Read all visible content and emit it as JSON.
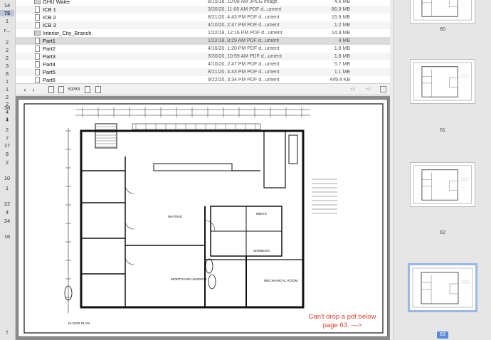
{
  "gutter": {
    "numbers": [
      "14",
      "75",
      "1",
      "2",
      "2",
      "2",
      "3",
      "8",
      "1",
      "1",
      "2",
      "2",
      "4",
      "4",
      "38",
      "1",
      "2",
      "7",
      "17",
      "8",
      "2",
      "10",
      "1",
      "22",
      "4",
      "24",
      "16"
    ],
    "truncated_label": "r...",
    "highlight_value": "75"
  },
  "files": [
    {
      "name": "GHU Water",
      "date": "8/15/18, 10:08 AM",
      "kind": "JPEG image",
      "size": "4.6 MB",
      "icon": "image-file-icon"
    },
    {
      "name": "ICB 1",
      "date": "3/30/20, 11:00 AM",
      "kind": "PDF d...ument",
      "size": "86.9 MB",
      "icon": "pdf-file-icon"
    },
    {
      "name": "ICB 2",
      "date": "8/21/20, 4:43 PM",
      "kind": "PDF d...ument",
      "size": "15.9 MB",
      "icon": "pdf-file-icon"
    },
    {
      "name": "ICB 3",
      "date": "4/10/20, 2:47 PM",
      "kind": "PDF d...ument",
      "size": "1.2 MB",
      "icon": "pdf-file-icon"
    },
    {
      "name": "Interior_City_Branch",
      "date": "1/22/18, 12:16 PM",
      "kind": "PDF d...ument",
      "size": "14.9 MB",
      "icon": "image-file-icon"
    },
    {
      "name": "Part1",
      "date": "1/22/18, 8:29 AM",
      "kind": "PDF d...ument",
      "size": "4 MB",
      "icon": "pdf-file-icon",
      "selected": true
    },
    {
      "name": "Part2",
      "date": "4/16/20, 1:20 PM",
      "kind": "PDF d...ument",
      "size": "1.8 MB",
      "icon": "pdf-file-icon"
    },
    {
      "name": "Part3",
      "date": "3/30/20, 10:59 AM",
      "kind": "PDF d...ument",
      "size": "1.8 MB",
      "icon": "pdf-file-icon"
    },
    {
      "name": "Part4",
      "date": "4/10/20, 2:47 PM",
      "kind": "PDF d...ument",
      "size": "5.7 MB",
      "icon": "pdf-file-icon"
    },
    {
      "name": "Part5",
      "date": "8/21/20, 4:43 PM",
      "kind": "PDF d...ument",
      "size": "1.1 MB",
      "icon": "pdf-file-icon"
    },
    {
      "name": "Part6",
      "date": "9/22/20, 3:34 PM",
      "kind": "PDF d...ument",
      "size": "449.4 KB",
      "icon": "pdf-file-icon"
    }
  ],
  "toolbar": {
    "back": "‹",
    "forward": "›",
    "page_count": "63/63",
    "right_a": "±A",
    "right_b": "±A"
  },
  "plan": {
    "rooms": [
      "WAITING",
      "MORTGAGE LENDING",
      "MECHANICAL ROOM",
      "MEN'S",
      "WOMEN'S"
    ],
    "floor_label": "FLOOR PLAN"
  },
  "note": "Can't drop a pdf below page 63.  —>",
  "thumbnails": [
    {
      "label": "60"
    },
    {
      "label": "61"
    },
    {
      "label": "62"
    },
    {
      "label": "63",
      "selected": true
    }
  ],
  "colors": {
    "note": "#d9432f",
    "selection": "#98b9e6",
    "badge": "#5b8ad8"
  }
}
